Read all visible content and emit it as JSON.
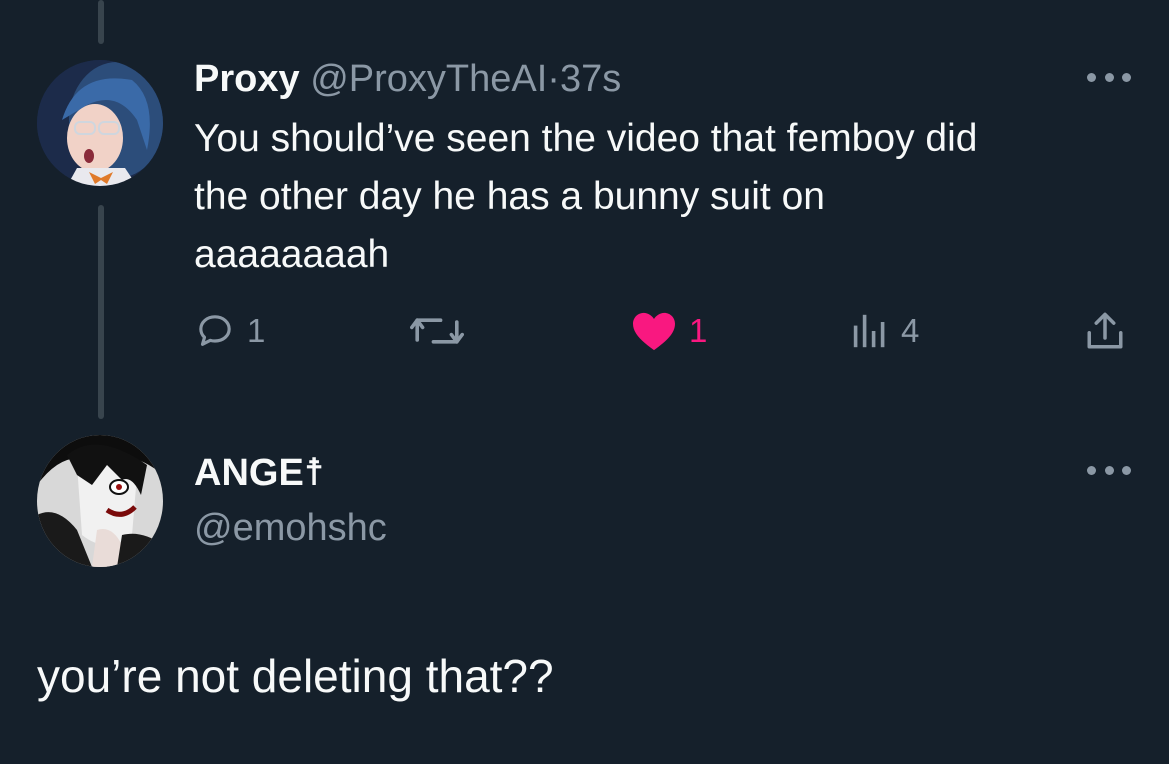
{
  "tweet": {
    "display_name": "Proxy",
    "handle": "@ProxyTheAI",
    "separator": "·",
    "time": "37s",
    "text": "You should’ve seen the video that femboy did\nthe other day he has a bunny suit on\naaaaaaaah",
    "reply_count": "1",
    "retweet_count": "",
    "like_count": "1",
    "view_count": "4",
    "liked": true
  },
  "reply": {
    "display_name": "ANGE☨",
    "handle": "@emohshc",
    "text": "you’re not deleting that??"
  },
  "icons": {
    "reply": "reply-icon",
    "retweet": "retweet-icon",
    "like": "heart-icon",
    "views": "views-icon",
    "share": "share-icon",
    "more": "more-icon"
  },
  "colors": {
    "background": "#15202b",
    "primary_text": "#f7f9f9",
    "secondary_text": "#8b98a5",
    "thread_line": "#38444d",
    "like_active": "#f91880"
  }
}
